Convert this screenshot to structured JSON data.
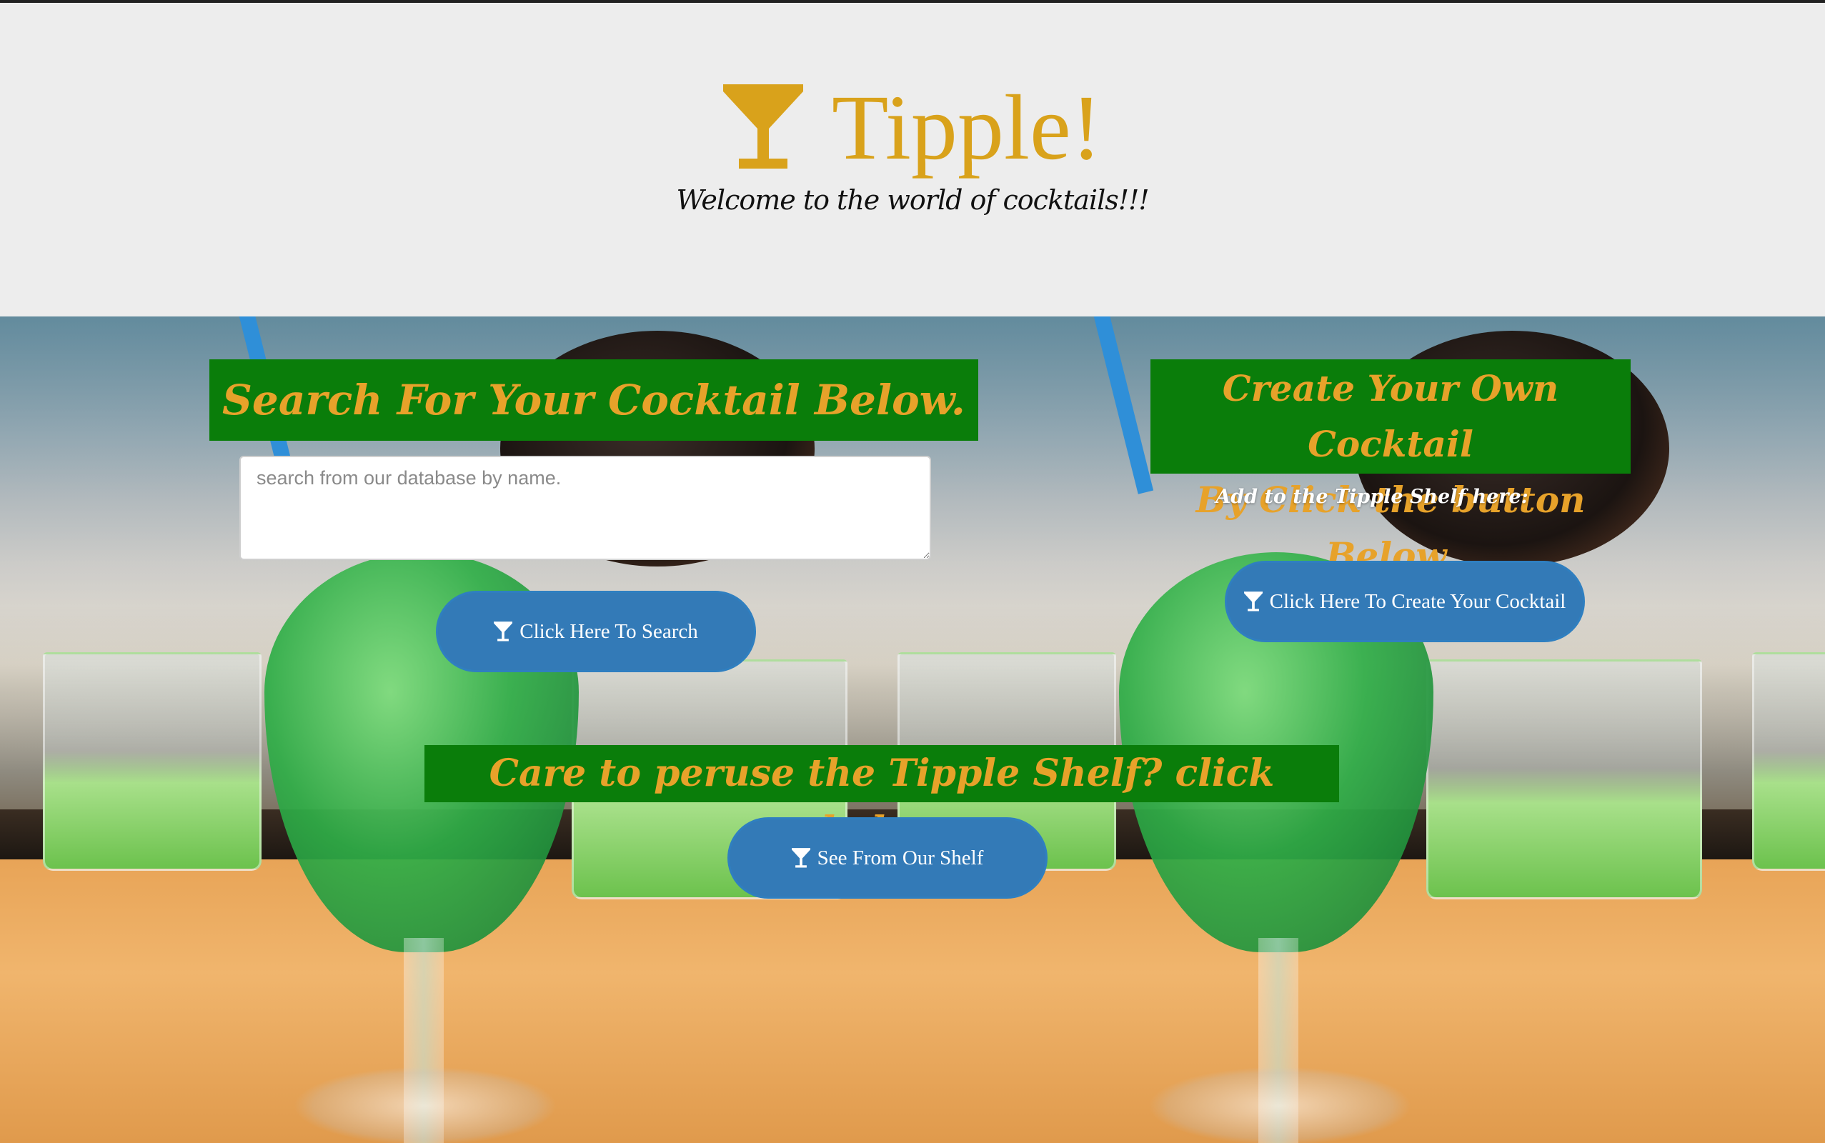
{
  "header": {
    "brand_title": "Tipple!",
    "tagline": "Welcome to the world of cocktails!!!",
    "accent_color": "#d9a21b",
    "icon": "cocktail-glass-icon"
  },
  "search": {
    "heading": "Search For Your Cocktail Below.",
    "placeholder": "search from our database by name.",
    "value": "",
    "button_label": "Click Here To Search",
    "button_icon": "cocktail-glass-icon"
  },
  "create": {
    "heading_line1": "Create Your Own Cocktail",
    "heading_line2": "By Click the button Below.",
    "hint": "Add to the Tipple Shelf here:",
    "button_label": "Click Here To Create Your Cocktail",
    "button_icon": "cocktail-glass-icon"
  },
  "shelf": {
    "heading": "Care to peruse the Tipple Shelf? click below",
    "button_label": "See From Our Shelf",
    "button_icon": "cocktail-glass-icon"
  },
  "colors": {
    "heading_bg": "#0a7d0a",
    "heading_text": "#e7a22a",
    "button_bg": "#337ab7",
    "header_bg": "#ededed"
  }
}
